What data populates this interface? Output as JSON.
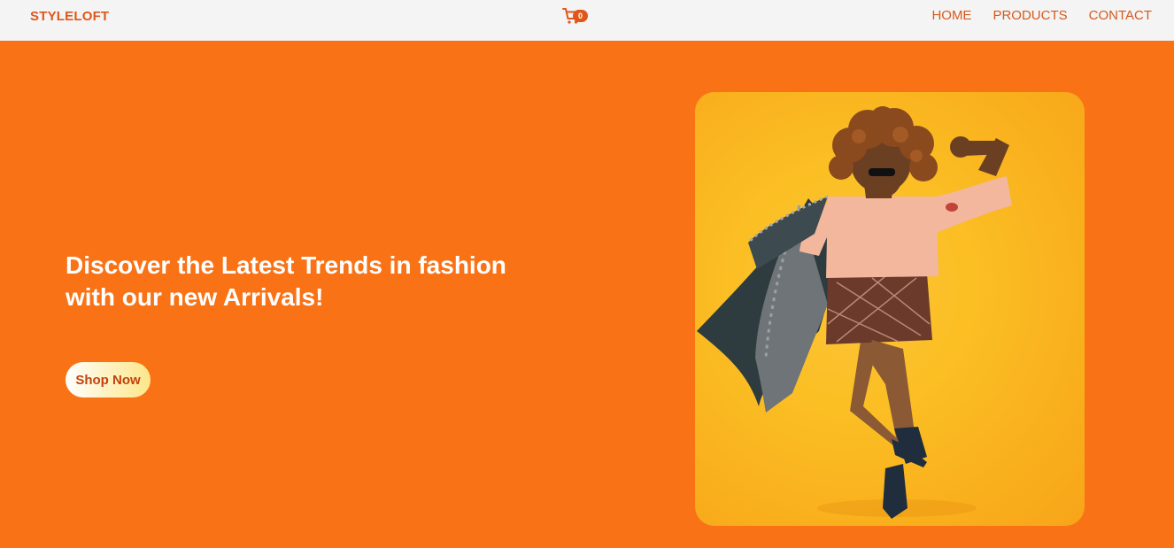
{
  "navbar": {
    "brand": "STYLELOFT",
    "cart": {
      "icon": "cart-icon",
      "count": "0"
    },
    "links": [
      "HOME",
      "PRODUCTS",
      "CONTACT"
    ]
  },
  "hero": {
    "title": "Discover the Latest Trends in fashion with our new Arrivals!",
    "cta_label": "Shop Now",
    "image_alt": "model posing in fashion outfit"
  },
  "colors": {
    "accent": "#f97316",
    "brand_text": "#e0561a",
    "navbar_bg": "#f4f4f4",
    "image_bg": "#fbbf24"
  }
}
